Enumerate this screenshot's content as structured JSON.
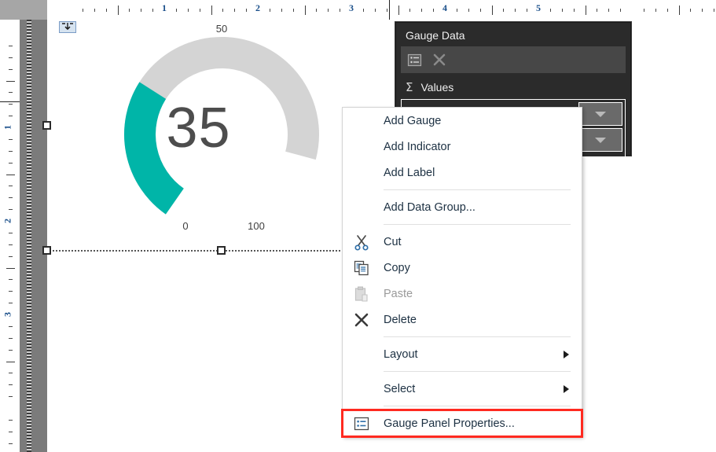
{
  "rulers": {
    "horizontal": {
      "numbers": [
        "1",
        "2",
        "3",
        "4",
        "5"
      ],
      "unit": "inches"
    },
    "vertical": {
      "numbers": [
        "1",
        "2",
        "3"
      ],
      "unit": "inches"
    }
  },
  "report_item": {
    "name": "Gauge Panel",
    "move_handle_icon": "move-handle-icon",
    "selected": true
  },
  "gauge": {
    "value_label": "35",
    "min_label": "0",
    "mid_label": "50",
    "max_label": "100",
    "fill_color": "#00b5a8",
    "track_color": "#d4d4d4"
  },
  "gauge_data_panel": {
    "title": "Gauge Data",
    "toolbar": [
      {
        "icon": "properties-icon",
        "label": "Properties"
      },
      {
        "icon": "close-x-icon",
        "label": "Delete"
      }
    ],
    "section": {
      "icon": "sigma-icon",
      "label": "Values"
    },
    "rows": [
      {
        "field": "",
        "dropdown_icon": "chevron-down-icon"
      },
      {
        "field": "",
        "dropdown_icon": "chevron-down-icon"
      }
    ]
  },
  "context_menu": {
    "items": [
      {
        "label": "Add Gauge",
        "icon": null,
        "disabled": false,
        "submenu": false,
        "highlighted": false
      },
      {
        "label": "Add Indicator",
        "icon": null,
        "disabled": false,
        "submenu": false,
        "highlighted": false
      },
      {
        "label": "Add Label",
        "icon": null,
        "disabled": false,
        "submenu": false,
        "highlighted": false
      },
      {
        "separator": true
      },
      {
        "label": "Add Data Group...",
        "icon": null,
        "disabled": false,
        "submenu": false,
        "highlighted": false
      },
      {
        "separator": true
      },
      {
        "label": "Cut",
        "icon": "scissors-icon",
        "disabled": false,
        "submenu": false,
        "highlighted": false
      },
      {
        "label": "Copy",
        "icon": "copy-icon",
        "disabled": false,
        "submenu": false,
        "highlighted": false
      },
      {
        "label": "Paste",
        "icon": "paste-icon",
        "disabled": true,
        "submenu": false,
        "highlighted": false
      },
      {
        "label": "Delete",
        "icon": "delete-x-icon",
        "disabled": false,
        "submenu": false,
        "highlighted": false
      },
      {
        "separator": true
      },
      {
        "label": "Layout",
        "icon": null,
        "disabled": false,
        "submenu": true,
        "highlighted": false
      },
      {
        "separator": true
      },
      {
        "label": "Select",
        "icon": null,
        "disabled": false,
        "submenu": true,
        "highlighted": false
      },
      {
        "separator": true
      },
      {
        "label": "Gauge Panel Properties...",
        "icon": "properties-icon",
        "disabled": false,
        "submenu": false,
        "highlighted": true
      }
    ],
    "highlight_color": "#ff2a20"
  }
}
